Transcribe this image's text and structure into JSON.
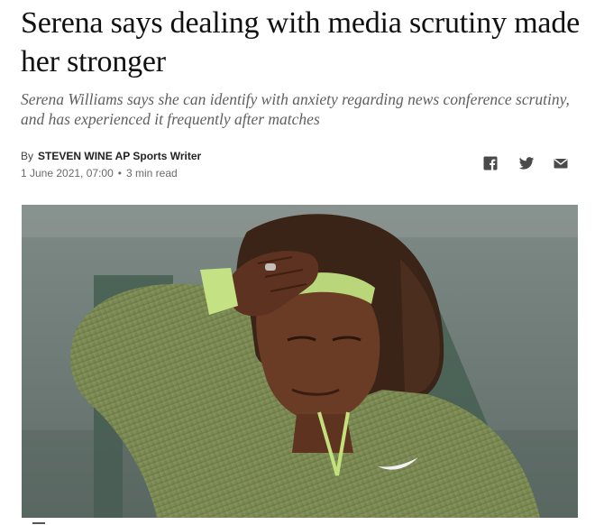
{
  "article": {
    "headline": "Serena says dealing with media scrutiny made her stronger",
    "standfirst": "Serena Williams says she can identify with anxiety regarding news conference scrutiny, and has experienced it frequently after matches",
    "byline": {
      "prefix": "By",
      "author": "STEVEN WINE AP Sports Writer"
    },
    "dateline": {
      "date": "1 June 2021, 07:00",
      "separator": "•",
      "read_time": "3 min read"
    },
    "share_icons": [
      "facebook-icon",
      "twitter-icon",
      "email-icon"
    ],
    "colors": {
      "headline": "#111111",
      "standfirst": "#5f5f5f",
      "meta": "#6a6a6a",
      "icon": "#4a4a4a"
    }
  }
}
